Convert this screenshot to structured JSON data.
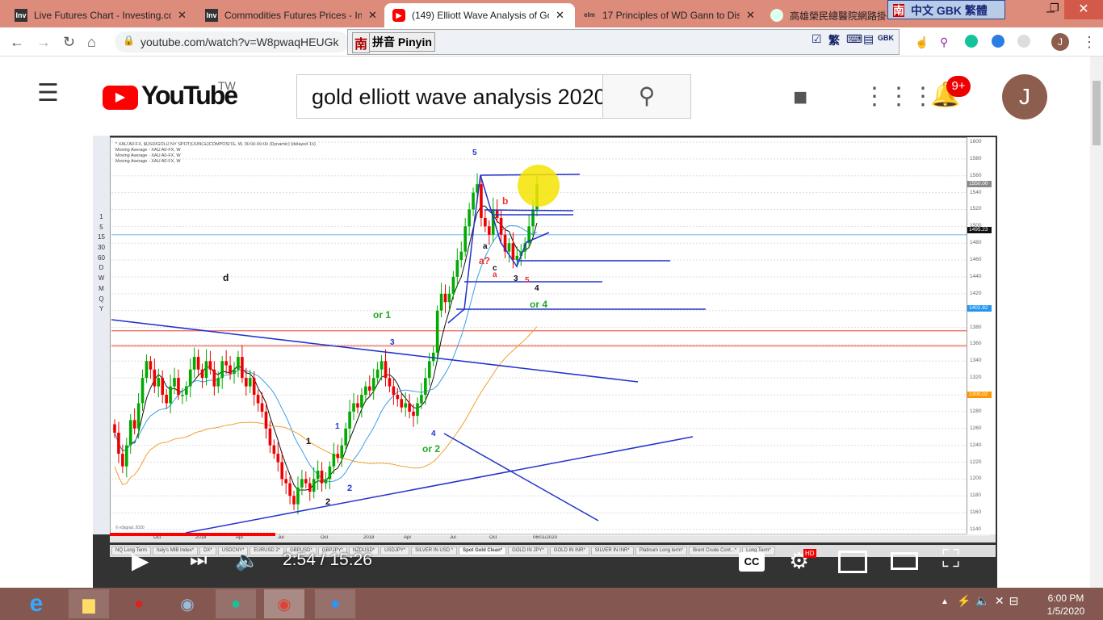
{
  "browser": {
    "tabs": [
      {
        "title": "Live Futures Chart - Investing.co",
        "favicon": "Inv"
      },
      {
        "title": "Commodities Futures Prices - In",
        "favicon": "Inv"
      },
      {
        "title": "(149) Elliott Wave Analysis of Go",
        "favicon": "youtube-icon",
        "active": true
      },
      {
        "title": "17 Principles of WD Gann to Dis",
        "favicon": "elm"
      },
      {
        "title": "高雄榮民總醫院網路掛",
        "favicon": "hospital-icon"
      }
    ],
    "url": "youtube.com/watch?v=W8pwaqHEUGk",
    "ime": {
      "logo": "南",
      "mode": "拼音 Pinyin",
      "lang_bar": "中文 GBK 繁體",
      "trad": "繁",
      "gbk": "GBK"
    },
    "profile_initial": "J"
  },
  "youtube": {
    "logo": "YouTube",
    "region": "TW",
    "search_value": "gold elliott wave analysis 2020",
    "notifications": "9+",
    "avatar": "J"
  },
  "chart": {
    "header": [
      "* XAU A0-FX, $USD/GOLD NY SPOT(OUNCE)COMPOSITE, W, 00:00-00:00 (Dynamic) (delayed 15)",
      "Moving Average - XAU A0-FX, W",
      "Moving Average - XAU A0-FX, W",
      "Moving Average - XAU A0-FX, W"
    ],
    "timeframes": [
      "1",
      "5",
      "15",
      "30",
      "60",
      "D",
      "W",
      "M",
      "Q",
      "Y"
    ],
    "copyright": "© eSignal, 2020",
    "xlabels": [
      "Oct",
      "2018",
      "Apr",
      "Jul",
      "Oct",
      "2019",
      "Apr",
      "Jul",
      "Oct",
      "06/01/2020"
    ],
    "badges": [
      {
        "v": "1550.00",
        "c": "#8a8a8a"
      },
      {
        "v": "1495.23",
        "c": "#111111"
      },
      {
        "v": "1402.82",
        "c": "#2196f3"
      },
      {
        "v": "1300.02",
        "c": "#ff9800"
      }
    ],
    "wave_labels": [
      "5",
      "b",
      "a",
      "a?",
      "c",
      "a",
      "3",
      "5",
      "4",
      "or 4",
      "d",
      "or 1",
      "3",
      "1",
      "1",
      "2",
      "2",
      "4",
      "or 2"
    ],
    "tabs": [
      "NQ Long Term",
      "Italy's MIB Index*",
      "DX*",
      "USDCNY*",
      "EURUSD 2*",
      "GBPUSD*",
      "GBPJPY*",
      "NZDUSD*",
      "USDJPY*",
      "SILVER IN USD *",
      "Spot Gold Clean*",
      "GOLD IN JPY*",
      "GOLD IN INR*",
      "SILVER IN INR*",
      "Platinum Long term*",
      "Brent Crude Cont...*",
      "Long Term*"
    ]
  },
  "chart_data": {
    "type": "candlestick",
    "title": "XAU A0-FX weekly",
    "yticks": [
      1600,
      1580,
      1560,
      1540,
      1520,
      1500,
      1480,
      1460,
      1440,
      1420,
      1400,
      1380,
      1360,
      1340,
      1320,
      1300,
      1280,
      1260,
      1240,
      1220,
      1200,
      1180,
      1160,
      1140
    ],
    "ylim": [
      1140,
      1600
    ],
    "closes": [
      1255,
      1230,
      1215,
      1240,
      1270,
      1260,
      1290,
      1320,
      1340,
      1330,
      1310,
      1320,
      1300,
      1290,
      1310,
      1320,
      1300,
      1300,
      1310,
      1330,
      1345,
      1330,
      1320,
      1340,
      1330,
      1310,
      1320,
      1340,
      1335,
      1325,
      1330,
      1345,
      1320,
      1310,
      1320,
      1300,
      1290,
      1280,
      1260,
      1240,
      1230,
      1220,
      1200,
      1195,
      1180,
      1170,
      1190,
      1200,
      1195,
      1185,
      1200,
      1210,
      1195,
      1200,
      1215,
      1230,
      1225,
      1240,
      1260,
      1280,
      1290,
      1285,
      1300,
      1310,
      1305,
      1320,
      1330,
      1340,
      1320,
      1310,
      1300,
      1295,
      1285,
      1290,
      1280,
      1275,
      1290,
      1300,
      1320,
      1340,
      1350,
      1400,
      1420,
      1410,
      1420,
      1440,
      1460,
      1470,
      1500,
      1520,
      1540,
      1550,
      1510,
      1500,
      1490,
      1520,
      1510,
      1490,
      1470,
      1480,
      1460,
      1465,
      1470,
      1480,
      1500,
      1520,
      1550
    ],
    "hlines": [
      {
        "price": 1376,
        "color": "#f06050"
      },
      {
        "price": 1358,
        "color": "#f06050"
      },
      {
        "price": 1490,
        "color": "#8ec5ee"
      }
    ]
  },
  "player": {
    "current": "2:54",
    "duration": "15:26",
    "time_display": "2:54 / 15:26",
    "progress": 0.188,
    "hd": "HD"
  },
  "taskbar": {
    "time": "6:00 PM",
    "date": "1/5/2020"
  }
}
